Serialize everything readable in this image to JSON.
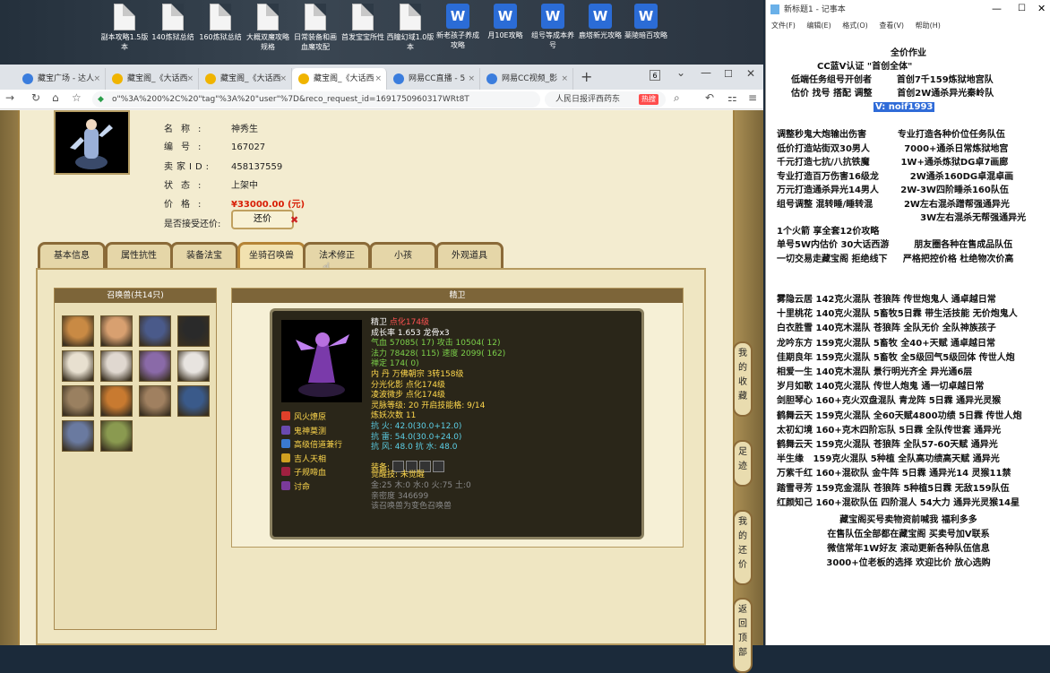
{
  "desktop": {
    "icons": [
      {
        "label": "副本攻略1.5版本",
        "type": "doc"
      },
      {
        "label": "140炼狱总结",
        "type": "doc"
      },
      {
        "label": "160炼狱总结",
        "type": "doc"
      },
      {
        "label": "大概双魔攻略规格",
        "type": "doc"
      },
      {
        "label": "日常装备和画血魔攻配",
        "type": "doc"
      },
      {
        "label": "首发宝宝所性",
        "type": "doc"
      },
      {
        "label": "西瞳幻域1.0版本",
        "type": "doc"
      },
      {
        "label": "新老孩子养成攻略",
        "type": "word"
      },
      {
        "label": "月10E攻略",
        "type": "word"
      },
      {
        "label": "组号等成本养号",
        "type": "word"
      },
      {
        "label": "鹿塔新光攻略",
        "type": "word"
      },
      {
        "label": "薬陵暗百攻略",
        "type": "word"
      }
    ]
  },
  "browser": {
    "tab_count": "6",
    "tabs": [
      {
        "label": "藏宝广场 - 达人",
        "color": "#3b7ddd"
      },
      {
        "label": "藏宝阁_《大话西",
        "color": "#f0b400"
      },
      {
        "label": "藏宝阁_《大话西",
        "color": "#f0b400"
      },
      {
        "label": "藏宝阁_《大话西",
        "color": "#f0b400"
      },
      {
        "label": "网易CC直播 - 5",
        "color": "#3b7ddd"
      },
      {
        "label": "网易CC视频_影",
        "color": "#3b7ddd"
      }
    ],
    "url": "o\"%3A%200%2C%20\"tag\"%3A%20\"user\"%7D&reco_request_id=1691750960317WRt8T",
    "search": "人民日报评西药东",
    "hot": "热搜"
  },
  "item": {
    "rows": [
      {
        "key": "名称:",
        "value": "神秀生"
      },
      {
        "key": "编号:",
        "value": "167027"
      },
      {
        "key": "卖家ID:",
        "value": "458137559"
      },
      {
        "key": "状态:",
        "value": "上架中"
      },
      {
        "key": "价格:",
        "value": "¥33000.00 (元)"
      }
    ],
    "haggle_label": "是否接受还价:",
    "haggle_button": "还价"
  },
  "tabs": [
    "基本信息",
    "属性抗性",
    "装备法宝",
    "坐骑召唤兽",
    "法术修正",
    "小孩",
    "外观道具"
  ],
  "pet_list": {
    "title": "召唤兽(共14只)",
    "colors": [
      "#c98a44",
      "#d8a070",
      "#4a5a8a",
      "#2a2a2a",
      "#e8e0d0",
      "#e0d8d0",
      "#8a6aa8",
      "#e8e4e0",
      "#9a8060",
      "#c87a30",
      "#a08060",
      "#3a5a8a",
      "#6a7aa0",
      "#8a9a50"
    ]
  },
  "detail": {
    "title": "精卫",
    "lines": [
      {
        "t": "精卫 ",
        "c": "w",
        "t2": "点化174级",
        "c2": "r"
      },
      {
        "t": "成长率 1.653 龙骨x3",
        "c": "w"
      },
      {
        "t": "气血 57085( 17) 攻击 10504( 12)",
        "c": "g"
      },
      {
        "t": "法力 78428( 115) 速度 2099( 162)",
        "c": "g"
      },
      {
        "t": "禅定 174( 0)",
        "c": "g"
      },
      {
        "t": "内    丹 万佛朝宗 3转158级",
        "c": "y"
      },
      {
        "t": "            分光化影 点化174级",
        "c": "y"
      },
      {
        "t": "            凌波微步 点化174级",
        "c": "y"
      },
      {
        "t": "灵脉等级: 20 开启技能格: 9/14",
        "c": "y"
      },
      {
        "t": "炼妖次数 11",
        "c": "y"
      },
      {
        "t": "抗    火: 42.0(30.0+12.0)",
        "c": "c"
      },
      {
        "t": "抗    雷: 54.0(30.0+24.0)",
        "c": "c"
      },
      {
        "t": "抗    风: 48.0 抗    水: 48.0",
        "c": "c"
      },
      {
        "t": "装备: ",
        "c": "y"
      },
      {
        "t": "觉醒技:  未觉醒",
        "c": "y"
      },
      {
        "t": "金:25 木:0 水:0 火:75 土:0",
        "c": "gr"
      },
      {
        "t": "亲密度 346699",
        "c": "gr"
      },
      {
        "t": "该召唤兽为变色召唤兽",
        "c": "gr"
      }
    ],
    "skills": [
      {
        "label": "风火燎原",
        "color": "#e0402a"
      },
      {
        "label": "鬼神莫测",
        "color": "#6a4ab0"
      },
      {
        "label": "高级倍道兼行",
        "color": "#3a7ad0"
      },
      {
        "label": "吉人天相",
        "color": "#d0a020"
      },
      {
        "label": "子规啼血",
        "color": "#a02040"
      },
      {
        "label": "讨命",
        "color": "#7a3a9a"
      }
    ]
  },
  "side_buttons": [
    "我的收藏",
    "足迹",
    "我的还价",
    "返回顶部"
  ],
  "notepad": {
    "title": "新标题1 - 记事本",
    "menu": [
      "文件(F)",
      "编辑(E)",
      "格式(O)",
      "查看(V)",
      "帮助(H)"
    ],
    "header": [
      "全价作业",
      "CC蓝V认证 \"首创全体\"",
      "低端任务组号开创者        首创7千159炼狱地宫队",
      "估价 找号 搭配 调整        首创2W通杀异光秦岭队"
    ],
    "contact": "V: noif1993",
    "services": [
      "调整秒鬼大炮输出伤害          专业打造各种价位任务队伍",
      "低价打造站街双30男人           7000+通杀日常炼狱地宫",
      "千元打造七抗/八抗铁魔          1W+通杀炼狱DG卓7画廊",
      "专业打造百万伤害16级龙          2W通杀160DG卓混卓画",
      "万元打造通杀异光14男人       2W-3W四阶睡杀160队伍",
      "组号调整 混转睡/睡转混          2W左右混杀蹭帮强通异光",
      "                                              3W左右混杀无帮强通异光",
      "1个火箭 享全套12价攻略",
      "单号5W内估价 30大话西游        朋友圈各种在售成品队伍",
      "一切交易走藏宝阁 拒绝线下     严格把控价格 杜绝物次价高"
    ],
    "teams": [
      "雾隐云居 142克火混队 苍狼阵 传世炮鬼人 通卓越日常",
      "十里桃花 140克火混队 5畜牧5日霖 带生活技能 无价炮鬼人",
      "白衣胜雪 140克木混队 苍狼阵 全队无价 全队神族孩子",
      "龙吟东方 159克火混队 5畜牧 全40+天赋 通卓越日常",
      "佳期良年 159克火混队 5畜牧 全5级回气5级回体 传世人炮",
      "相爱一生 140克木混队 景行明光齐全 异光通6层",
      "岁月如歌 140克火混队 传世人炮鬼 通一切卓越日常",
      "剑胆琴心 160+克火双盘混队 青龙阵 5日霖 通异光灵猴",
      "鹤舞云天 159克火混队 全60天赋4800功绩 5日霖 传世人炮",
      "太初幻境 160+克木四阶忘队 5日霖 全队传世套 通异光",
      "鹤舞云天 159克火混队 苍狼阵 全队57-60天赋 通异光",
      "半生缘   159克火混队 5种植 全队高功绩高天赋 通异光",
      "万紫千红 160+混砍队 金牛阵 5日霖 通异光14 灵猴11禁",
      "踏雪寻芳 159克金混队 苍狼阵 5种植5日霖 无敌159队伍",
      "红颜知己 160+混砍队伍 四阶混人 54大力 通异光灵猴14星"
    ],
    "footer": [
      "藏宝阁买号卖物资前喊我 福利多多",
      "在售队伍全部都在藏宝阁 买卖号加V联系",
      "微信常年1W好友 滚动更新各种队伍信息",
      "3000+位老板的选择 欢迎比价 放心选购"
    ]
  }
}
